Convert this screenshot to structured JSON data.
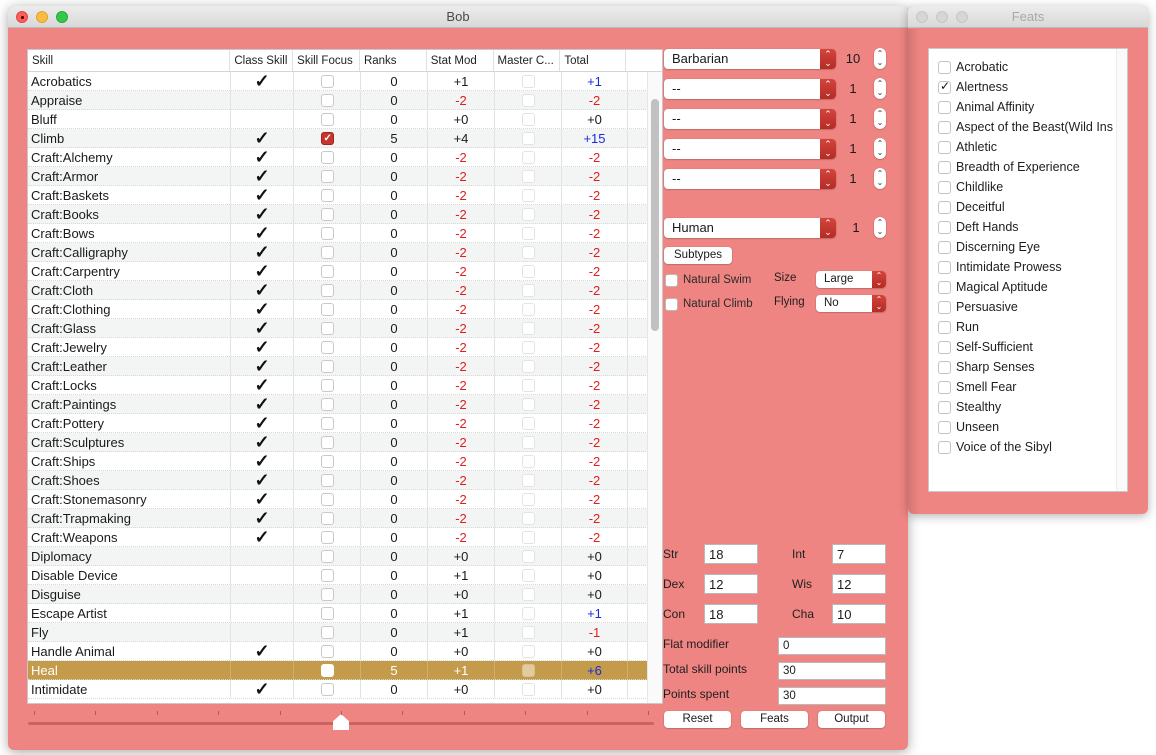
{
  "main_window": {
    "title": "Bob"
  },
  "skills_table": {
    "columns": [
      "Skill",
      "Class Skill",
      "Skill Focus",
      "Ranks",
      "Stat Mod",
      "Master C...",
      "Total"
    ],
    "rows": [
      {
        "skill": "Acrobatics",
        "class_skill": true,
        "skill_focus": false,
        "ranks": "0",
        "stat_mod": "+1",
        "master": false,
        "total": "+1"
      },
      {
        "skill": "Appraise",
        "class_skill": false,
        "skill_focus": false,
        "ranks": "0",
        "stat_mod": "-2",
        "master": false,
        "total": "-2"
      },
      {
        "skill": "Bluff",
        "class_skill": false,
        "skill_focus": false,
        "ranks": "0",
        "stat_mod": "+0",
        "master": false,
        "total": "+0"
      },
      {
        "skill": "Climb",
        "class_skill": true,
        "skill_focus": true,
        "ranks": "5",
        "stat_mod": "+4",
        "master": false,
        "total": "+15"
      },
      {
        "skill": "Craft:Alchemy",
        "class_skill": true,
        "skill_focus": false,
        "ranks": "0",
        "stat_mod": "-2",
        "master": false,
        "total": "-2"
      },
      {
        "skill": "Craft:Armor",
        "class_skill": true,
        "skill_focus": false,
        "ranks": "0",
        "stat_mod": "-2",
        "master": false,
        "total": "-2"
      },
      {
        "skill": "Craft:Baskets",
        "class_skill": true,
        "skill_focus": false,
        "ranks": "0",
        "stat_mod": "-2",
        "master": false,
        "total": "-2"
      },
      {
        "skill": "Craft:Books",
        "class_skill": true,
        "skill_focus": false,
        "ranks": "0",
        "stat_mod": "-2",
        "master": false,
        "total": "-2"
      },
      {
        "skill": "Craft:Bows",
        "class_skill": true,
        "skill_focus": false,
        "ranks": "0",
        "stat_mod": "-2",
        "master": false,
        "total": "-2"
      },
      {
        "skill": "Craft:Calligraphy",
        "class_skill": true,
        "skill_focus": false,
        "ranks": "0",
        "stat_mod": "-2",
        "master": false,
        "total": "-2"
      },
      {
        "skill": "Craft:Carpentry",
        "class_skill": true,
        "skill_focus": false,
        "ranks": "0",
        "stat_mod": "-2",
        "master": false,
        "total": "-2"
      },
      {
        "skill": "Craft:Cloth",
        "class_skill": true,
        "skill_focus": false,
        "ranks": "0",
        "stat_mod": "-2",
        "master": false,
        "total": "-2"
      },
      {
        "skill": "Craft:Clothing",
        "class_skill": true,
        "skill_focus": false,
        "ranks": "0",
        "stat_mod": "-2",
        "master": false,
        "total": "-2"
      },
      {
        "skill": "Craft:Glass",
        "class_skill": true,
        "skill_focus": false,
        "ranks": "0",
        "stat_mod": "-2",
        "master": false,
        "total": "-2"
      },
      {
        "skill": "Craft:Jewelry",
        "class_skill": true,
        "skill_focus": false,
        "ranks": "0",
        "stat_mod": "-2",
        "master": false,
        "total": "-2"
      },
      {
        "skill": "Craft:Leather",
        "class_skill": true,
        "skill_focus": false,
        "ranks": "0",
        "stat_mod": "-2",
        "master": false,
        "total": "-2"
      },
      {
        "skill": "Craft:Locks",
        "class_skill": true,
        "skill_focus": false,
        "ranks": "0",
        "stat_mod": "-2",
        "master": false,
        "total": "-2"
      },
      {
        "skill": "Craft:Paintings",
        "class_skill": true,
        "skill_focus": false,
        "ranks": "0",
        "stat_mod": "-2",
        "master": false,
        "total": "-2"
      },
      {
        "skill": "Craft:Pottery",
        "class_skill": true,
        "skill_focus": false,
        "ranks": "0",
        "stat_mod": "-2",
        "master": false,
        "total": "-2"
      },
      {
        "skill": "Craft:Sculptures",
        "class_skill": true,
        "skill_focus": false,
        "ranks": "0",
        "stat_mod": "-2",
        "master": false,
        "total": "-2"
      },
      {
        "skill": "Craft:Ships",
        "class_skill": true,
        "skill_focus": false,
        "ranks": "0",
        "stat_mod": "-2",
        "master": false,
        "total": "-2"
      },
      {
        "skill": "Craft:Shoes",
        "class_skill": true,
        "skill_focus": false,
        "ranks": "0",
        "stat_mod": "-2",
        "master": false,
        "total": "-2"
      },
      {
        "skill": "Craft:Stonemasonry",
        "class_skill": true,
        "skill_focus": false,
        "ranks": "0",
        "stat_mod": "-2",
        "master": false,
        "total": "-2"
      },
      {
        "skill": "Craft:Trapmaking",
        "class_skill": true,
        "skill_focus": false,
        "ranks": "0",
        "stat_mod": "-2",
        "master": false,
        "total": "-2"
      },
      {
        "skill": "Craft:Weapons",
        "class_skill": true,
        "skill_focus": false,
        "ranks": "0",
        "stat_mod": "-2",
        "master": false,
        "total": "-2"
      },
      {
        "skill": "Diplomacy",
        "class_skill": false,
        "skill_focus": false,
        "ranks": "0",
        "stat_mod": "+0",
        "master": false,
        "total": "+0"
      },
      {
        "skill": "Disable Device",
        "class_skill": false,
        "skill_focus": false,
        "ranks": "0",
        "stat_mod": "+1",
        "master": false,
        "total": "+0"
      },
      {
        "skill": "Disguise",
        "class_skill": false,
        "skill_focus": false,
        "ranks": "0",
        "stat_mod": "+0",
        "master": false,
        "total": "+0"
      },
      {
        "skill": "Escape Artist",
        "class_skill": false,
        "skill_focus": false,
        "ranks": "0",
        "stat_mod": "+1",
        "master": false,
        "total": "+1"
      },
      {
        "skill": "Fly",
        "class_skill": false,
        "skill_focus": false,
        "ranks": "0",
        "stat_mod": "+1",
        "master": false,
        "total": "-1"
      },
      {
        "skill": "Handle Animal",
        "class_skill": true,
        "skill_focus": false,
        "ranks": "0",
        "stat_mod": "+0",
        "master": false,
        "total": "+0"
      },
      {
        "skill": "Heal",
        "class_skill": false,
        "skill_focus": false,
        "ranks": "5",
        "stat_mod": "+1",
        "master": false,
        "total": "+6",
        "selected": true
      },
      {
        "skill": "Intimidate",
        "class_skill": true,
        "skill_focus": false,
        "ranks": "0",
        "stat_mod": "+0",
        "master": false,
        "total": "+0"
      }
    ]
  },
  "slider": {
    "value_fraction": 0.5,
    "tick_count": 11
  },
  "classes": [
    {
      "name": "Barbarian",
      "level": "10"
    },
    {
      "name": "--",
      "level": "1"
    },
    {
      "name": "--",
      "level": "1"
    },
    {
      "name": "--",
      "level": "1"
    },
    {
      "name": "--",
      "level": "1"
    }
  ],
  "race": {
    "name": "Human",
    "level": "1",
    "subtypes_label": "Subtypes",
    "natural_swim_label": "Natural Swim",
    "natural_swim": false,
    "natural_climb_label": "Natural Climb",
    "natural_climb": false,
    "size_label": "Size",
    "size_value": "Large",
    "flying_label": "Flying",
    "flying_value": "No"
  },
  "stats": {
    "str_label": "Str",
    "str": "18",
    "dex_label": "Dex",
    "dex": "12",
    "con_label": "Con",
    "con": "18",
    "int_label": "Int",
    "int": "7",
    "wis_label": "Wis",
    "wis": "12",
    "cha_label": "Cha",
    "cha": "10"
  },
  "points": {
    "flat_modifier_label": "Flat modifier",
    "flat_modifier": "0",
    "total_skill_points_label": "Total skill points",
    "total_skill_points": "30",
    "points_spent_label": "Points spent",
    "points_spent": "30"
  },
  "buttons": {
    "reset": "Reset",
    "feats": "Feats",
    "output": "Output"
  },
  "feats_window": {
    "title": "Feats",
    "items": [
      {
        "label": "Acrobatic",
        "checked": false
      },
      {
        "label": "Alertness",
        "checked": true
      },
      {
        "label": "Animal Affinity",
        "checked": false
      },
      {
        "label": "Aspect of the Beast(Wild Ins",
        "checked": false
      },
      {
        "label": "Athletic",
        "checked": false
      },
      {
        "label": "Breadth of Experience",
        "checked": false
      },
      {
        "label": "Childlike",
        "checked": false
      },
      {
        "label": "Deceitful",
        "checked": false
      },
      {
        "label": "Deft Hands",
        "checked": false
      },
      {
        "label": "Discerning Eye",
        "checked": false
      },
      {
        "label": "Intimidate Prowess",
        "checked": false
      },
      {
        "label": "Magical Aptitude",
        "checked": false
      },
      {
        "label": "Persuasive",
        "checked": false
      },
      {
        "label": "Run",
        "checked": false
      },
      {
        "label": "Self-Sufficient",
        "checked": false
      },
      {
        "label": "Sharp Senses",
        "checked": false
      },
      {
        "label": "Smell Fear",
        "checked": false
      },
      {
        "label": "Stealthy",
        "checked": false
      },
      {
        "label": "Unseen",
        "checked": false
      },
      {
        "label": "Voice of the Sibyl",
        "checked": false
      }
    ]
  },
  "colors": {
    "window_bg": "#ef8582",
    "selected_row": "#c49a4b",
    "positive": "#1a2bdc",
    "negative": "#e01e1e",
    "popup_arrow": "#c8352f"
  }
}
